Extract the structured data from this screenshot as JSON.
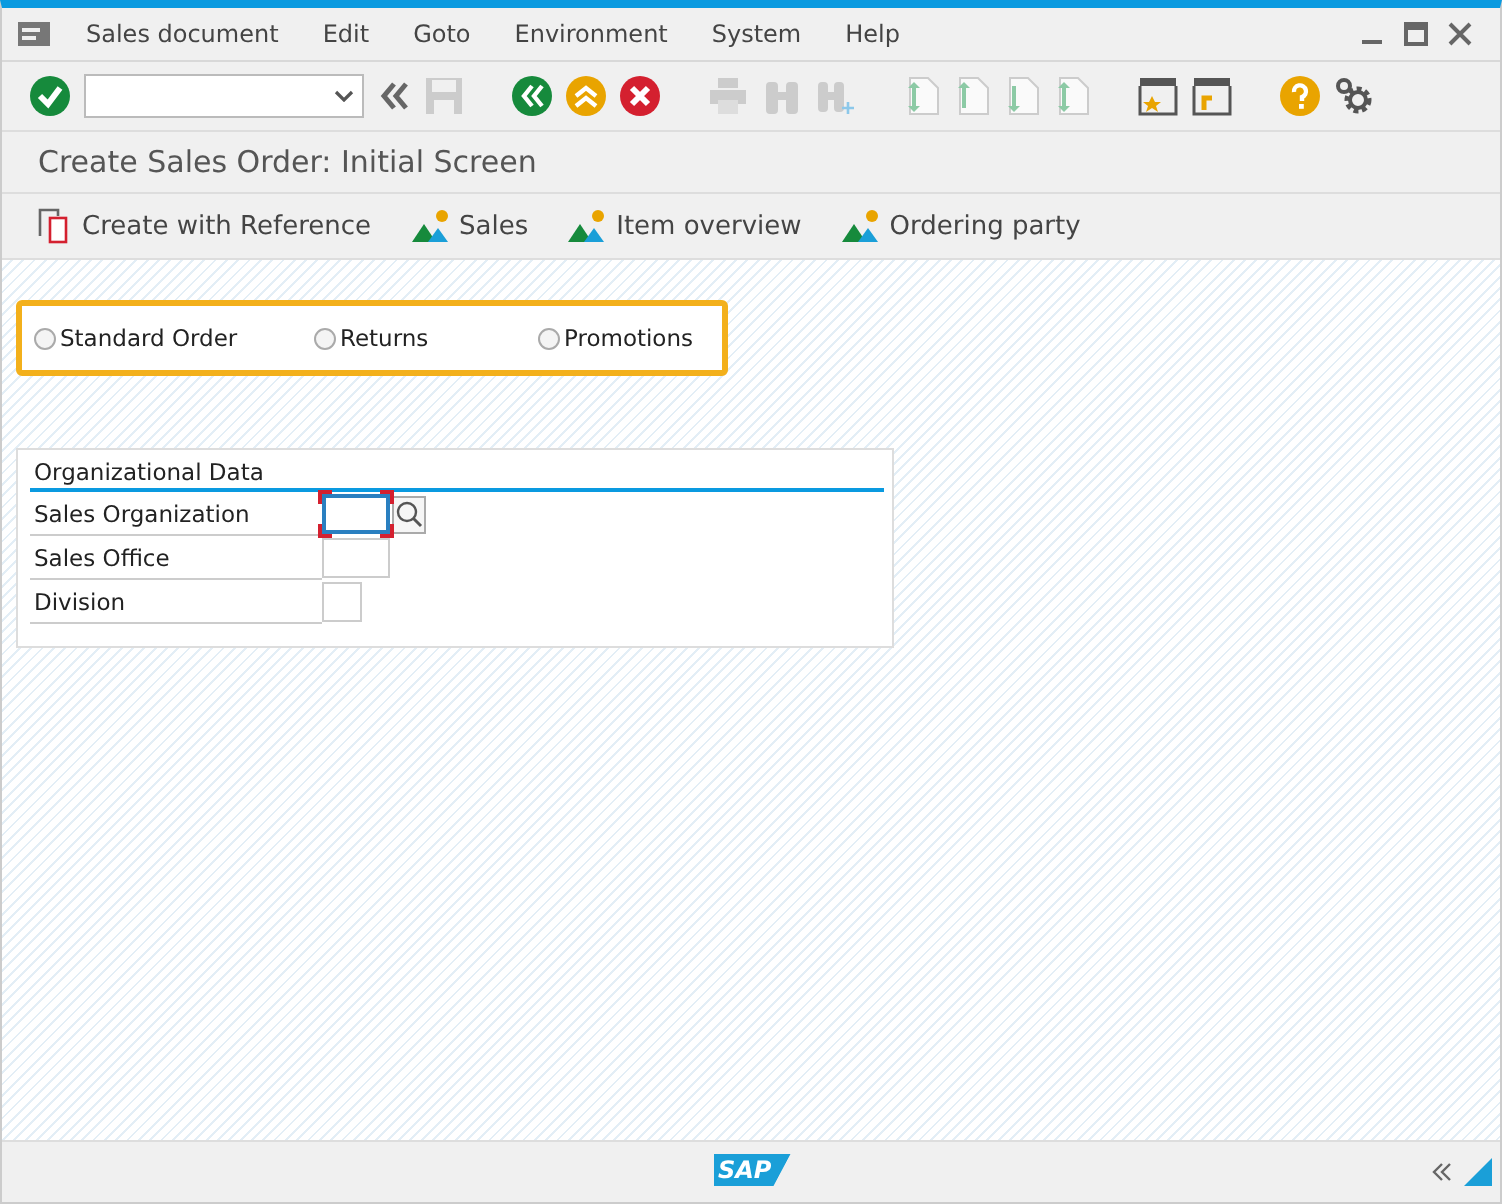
{
  "menu": [
    "Sales document",
    "Edit",
    "Goto",
    "Environment",
    "System",
    "Help"
  ],
  "title": "Create Sales Order: Initial Screen",
  "app_toolbar": [
    {
      "label": "Create with Reference",
      "kind": "copy"
    },
    {
      "label": "Sales",
      "kind": "overview"
    },
    {
      "label": "Item overview",
      "kind": "overview"
    },
    {
      "label": "Ordering party",
      "kind": "overview"
    }
  ],
  "order_types": [
    {
      "label": "Standard Order",
      "selected": false
    },
    {
      "label": "Returns",
      "selected": false
    },
    {
      "label": "Promotions",
      "selected": false
    }
  ],
  "org_data": {
    "title": "Organizational Data",
    "fields": [
      {
        "label": "Sales Organization",
        "required": true,
        "search_help": true,
        "focused": true
      },
      {
        "label": "Sales Office",
        "required": false,
        "search_help": false,
        "focused": false
      },
      {
        "label": "Division",
        "required": false,
        "search_help": false,
        "focused": false
      }
    ]
  },
  "footer": {
    "logo": "SAP"
  }
}
